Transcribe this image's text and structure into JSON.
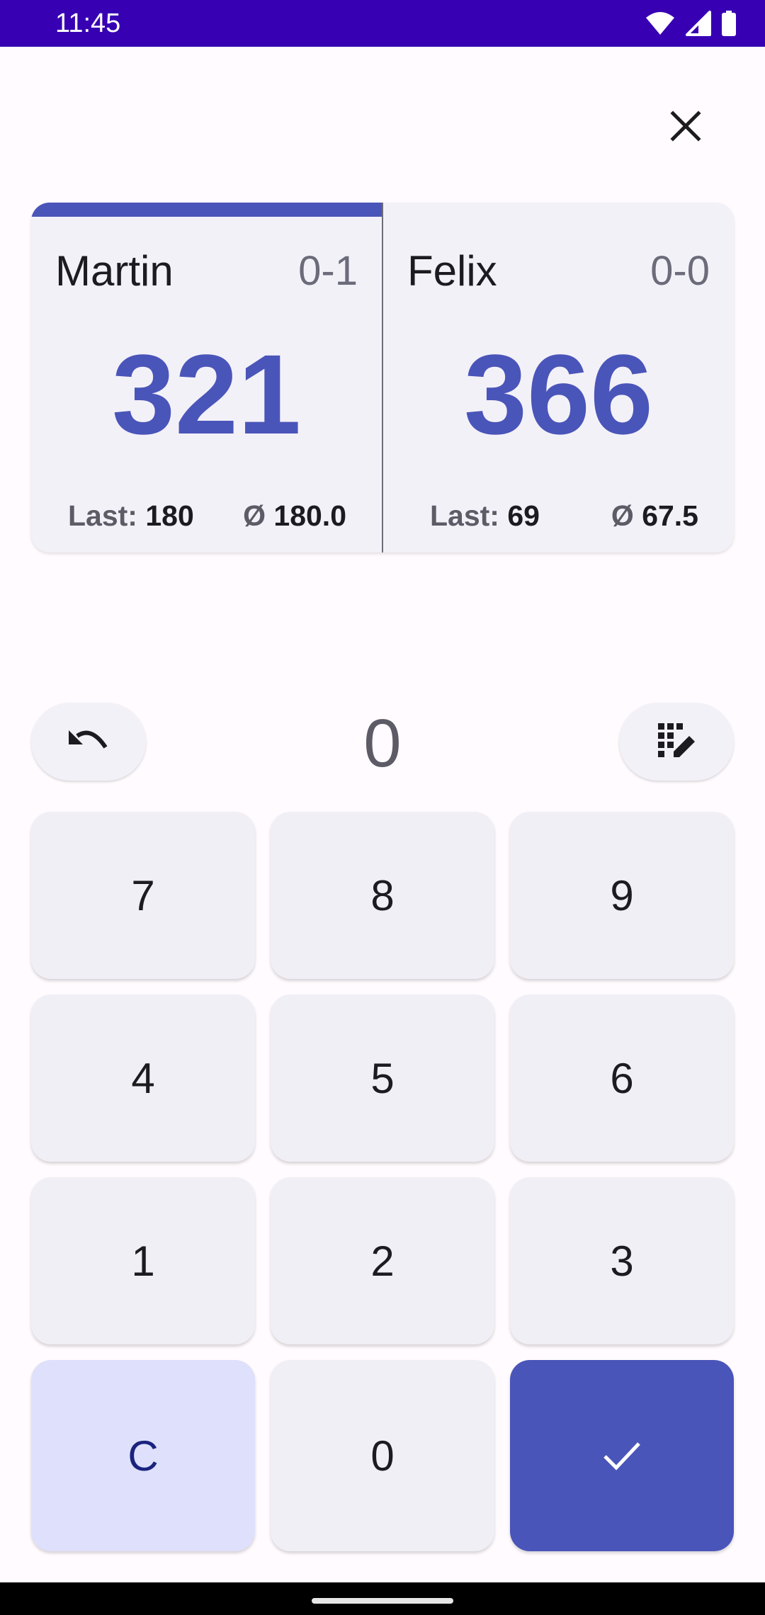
{
  "status_bar": {
    "time": "11:45"
  },
  "players": [
    {
      "name": "Martin",
      "sets": "0-1",
      "score": "321",
      "last_label": "Last:",
      "last_value": "180",
      "avg_label": "Ø",
      "avg_value": "180.0",
      "active": true
    },
    {
      "name": "Felix",
      "sets": "0-0",
      "score": "366",
      "last_label": "Last:",
      "last_value": "69",
      "avg_label": "Ø",
      "avg_value": "67.5",
      "active": false
    }
  ],
  "input": {
    "current_value": "0"
  },
  "keypad": {
    "keys": [
      "7",
      "8",
      "9",
      "4",
      "5",
      "6",
      "1",
      "2",
      "3"
    ],
    "clear_label": "C",
    "zero_label": "0"
  },
  "icons": {
    "close": "close-icon",
    "undo": "undo-icon",
    "keypad_edit": "keypad-edit-icon",
    "confirm": "check-icon"
  },
  "colors": {
    "status_bar": "#3700B3",
    "accent": "#4A55B9",
    "clear_key": "#DFE0FB"
  }
}
